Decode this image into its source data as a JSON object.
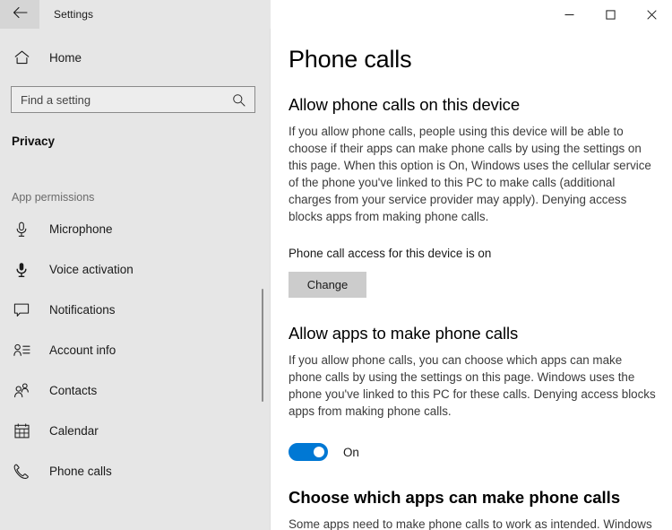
{
  "window": {
    "app_title": "Settings",
    "back_icon": "back-arrow-icon",
    "caption": {
      "minimize_label": "Minimize",
      "maximize_label": "Maximize",
      "close_label": "Close"
    }
  },
  "sidebar": {
    "home": {
      "label": "Home",
      "icon": "home-icon"
    },
    "search": {
      "placeholder": "Find a setting",
      "value": "",
      "icon": "search-icon"
    },
    "category": "Privacy",
    "group_label": "App permissions",
    "items": [
      {
        "label": "Microphone",
        "icon": "microphone-icon"
      },
      {
        "label": "Voice activation",
        "icon": "voice-activation-icon"
      },
      {
        "label": "Notifications",
        "icon": "notifications-icon"
      },
      {
        "label": "Account info",
        "icon": "account-info-icon"
      },
      {
        "label": "Contacts",
        "icon": "contacts-icon"
      },
      {
        "label": "Calendar",
        "icon": "calendar-icon"
      },
      {
        "label": "Phone calls",
        "icon": "phone-calls-icon"
      }
    ]
  },
  "main": {
    "page_title": "Phone calls",
    "section_device": {
      "heading": "Allow phone calls on this device",
      "description": "If you allow phone calls, people using this device will be able to choose if their apps can make phone calls by using the settings on this page. When this option is On, Windows uses the cellular service of the phone you've linked to this PC to make calls (additional charges from your service provider may apply). Denying access blocks apps from making phone calls.",
      "status": "Phone call access for this device is on",
      "change_button": "Change"
    },
    "section_apps": {
      "heading": "Allow apps to make phone calls",
      "description": "If you allow phone calls, you can choose which apps can make phone calls by using the settings on this page. Windows uses the phone you've linked to this PC for these calls. Denying access blocks apps from making phone calls.",
      "toggle_state": "On"
    },
    "section_choose": {
      "heading": "Choose which apps can make phone calls",
      "description": "Some apps need to make phone calls to work as intended. Windows"
    }
  },
  "colors": {
    "sidebar_bg": "#e6e6e6",
    "accent": "#0078d4",
    "button_bg": "#cccccc",
    "body_text": "#3b3b3b"
  }
}
